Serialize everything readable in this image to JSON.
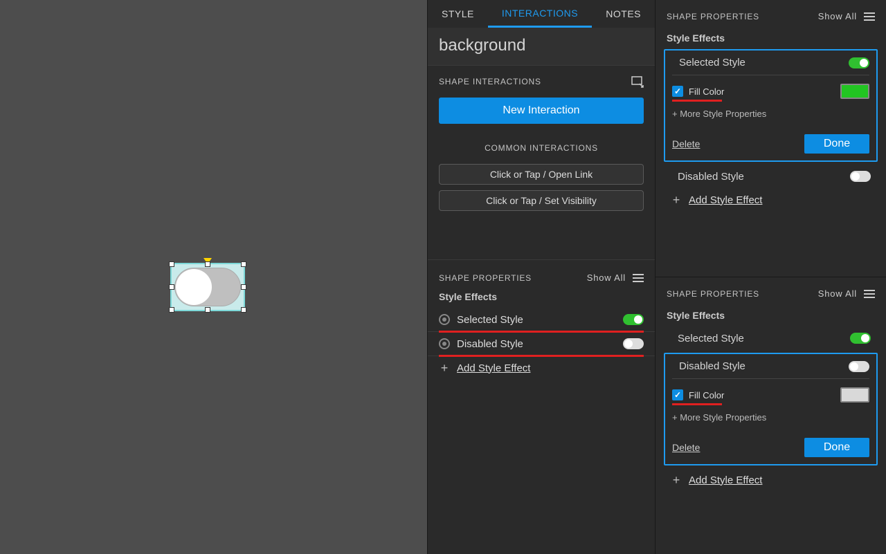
{
  "tabs": {
    "style": "STYLE",
    "interactions": "INTERACTIONS",
    "notes": "NOTES"
  },
  "objectName": "background",
  "midPanel": {
    "shapeInteractions": "SHAPE INTERACTIONS",
    "newInteraction": "New Interaction",
    "commonInteractions": "COMMON INTERACTIONS",
    "commonItems": [
      "Click or Tap / Open Link",
      "Click or Tap / Set Visibility"
    ],
    "shapeProperties": "SHAPE PROPERTIES",
    "showAll": "Show All",
    "styleEffects": "Style Effects",
    "selectedStyle": "Selected Style",
    "disabledStyle": "Disabled Style",
    "addStyleEffect": "Add Style Effect"
  },
  "right": {
    "shapeProperties": "SHAPE PROPERTIES",
    "showAll": "Show All",
    "styleEffects": "Style Effects",
    "selectedStyle": "Selected Style",
    "disabledStyle": "Disabled Style",
    "fillColor": "Fill Color",
    "moreStyleProps": "+ More Style Properties",
    "delete": "Delete",
    "done": "Done",
    "addStyleEffect": "Add Style Effect",
    "fillColor2SwatchHex": "#d9d9d9",
    "fillColor1SwatchHex": "#22c522"
  }
}
